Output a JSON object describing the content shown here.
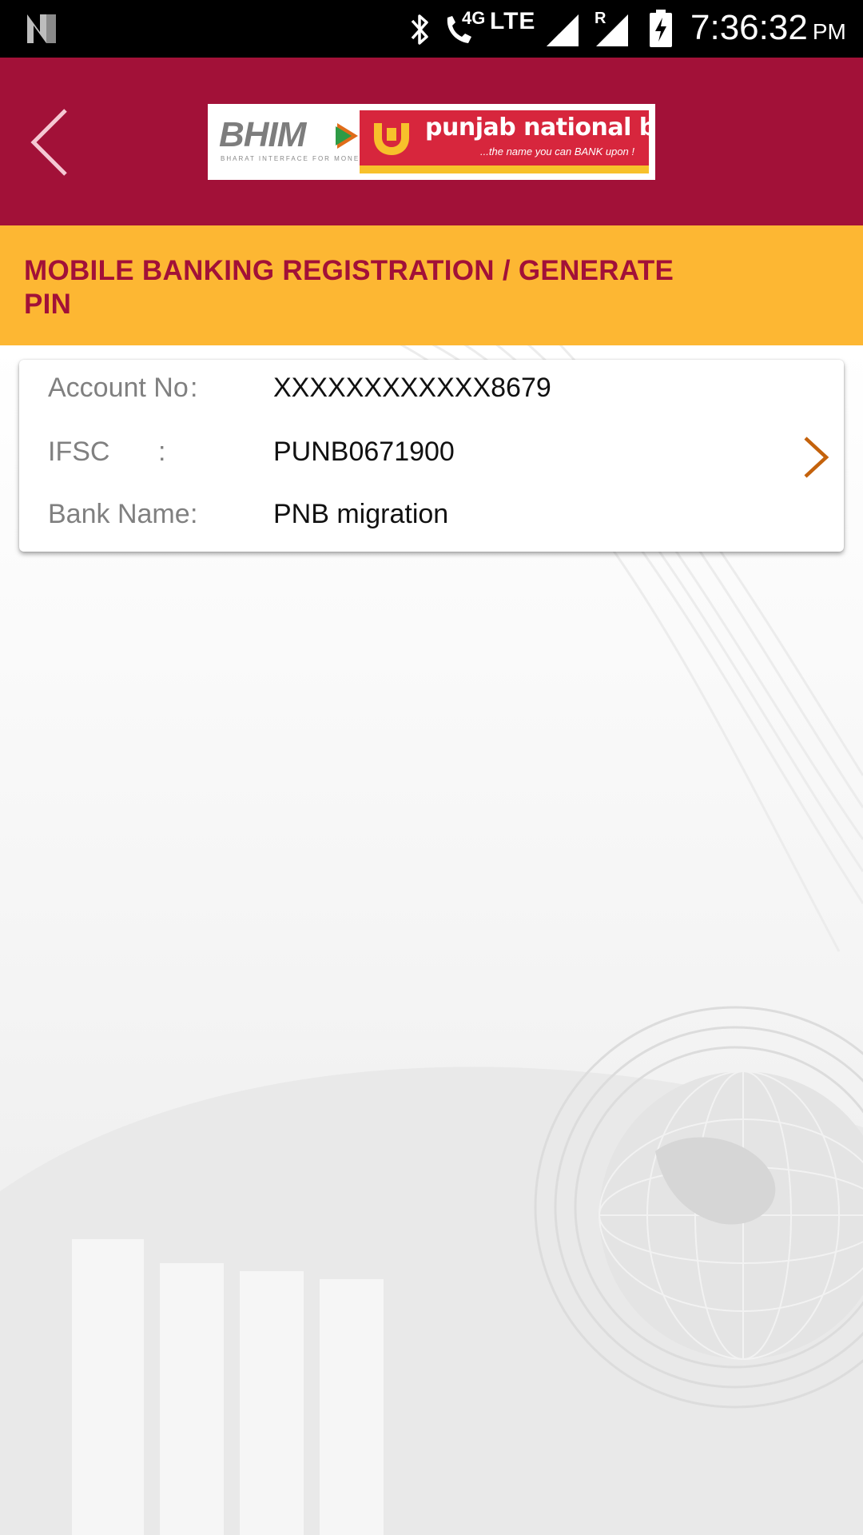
{
  "status_bar": {
    "network_4g": "4G",
    "network_type": "LTE",
    "roaming": "R",
    "time": "7:36:32",
    "ampm": "PM",
    "icons": [
      "n-logo-icon",
      "bluetooth-icon",
      "wifi-call-icon",
      "signal-icon",
      "signal-roaming-icon",
      "battery-charging-icon"
    ]
  },
  "header": {
    "back_icon": "back-chevron-icon",
    "logo": {
      "bhim_text": "BHIM",
      "bhim_subtitle": "BHARAT INTERFACE FOR MONEY",
      "bank_name": "punjab national bank",
      "bank_tagline": "...the name you can BANK upon !"
    }
  },
  "section": {
    "title": "MOBILE BANKING REGISTRATION / GENERATE PIN"
  },
  "account_card": {
    "rows": [
      {
        "label": "Account No",
        "colon": ":",
        "value": "XXXXXXXXXXXX8679"
      },
      {
        "label": "IFSC",
        "colon": ":",
        "value": "PUNB0671900"
      },
      {
        "label": "Bank Name",
        "colon": ":",
        "value": "PNB migration"
      }
    ],
    "action_icon": "chevron-right-icon"
  },
  "colors": {
    "header_bg": "#a21138",
    "section_bg": "#fdb733",
    "title_text": "#a21138",
    "chevron": "#c4620c"
  }
}
